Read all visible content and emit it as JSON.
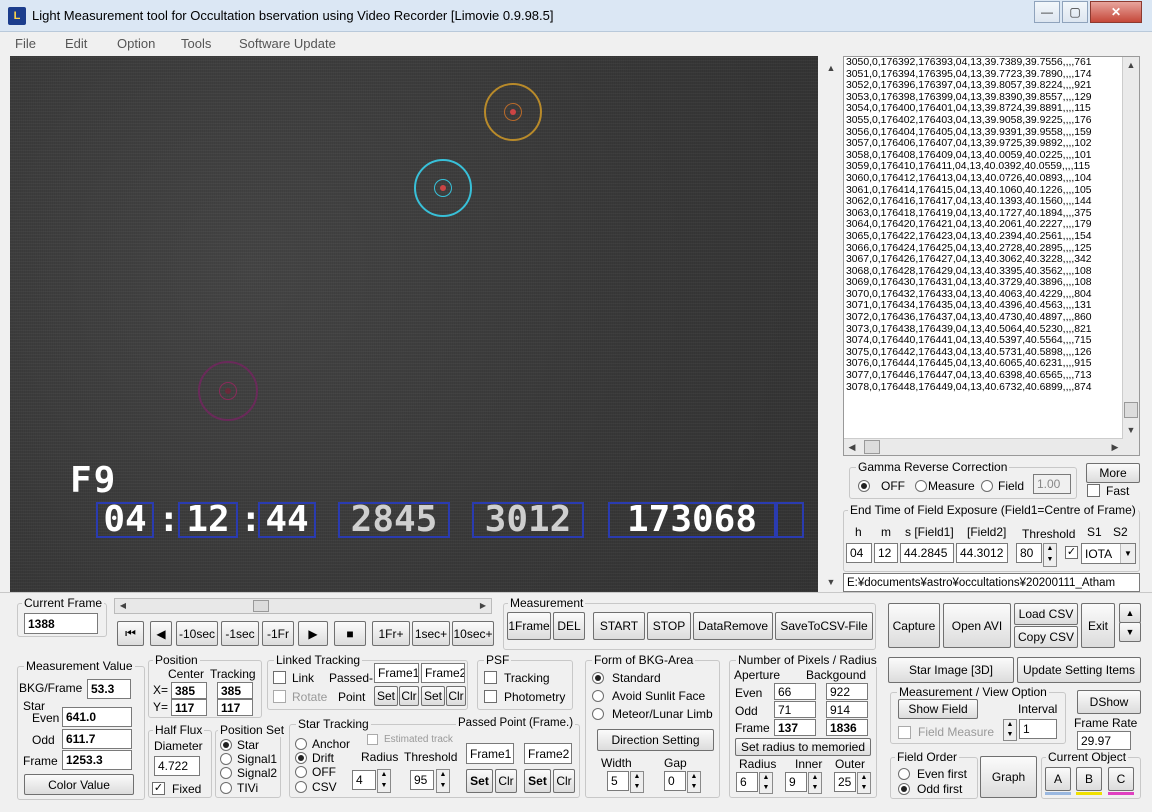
{
  "window": {
    "title": "Light Measurement tool for Occultation bservation using Video Recorder [Limovie 0.9.98.5]",
    "icon_text": "L"
  },
  "controls": {
    "minimize": "—",
    "maximize": "▢",
    "close": "✕"
  },
  "menu": [
    "File",
    "Edit",
    "Option",
    "Tools",
    "Software Update"
  ],
  "video": {
    "osd_field": "F9",
    "osd_time": [
      "04",
      ":",
      "12",
      ":",
      "44"
    ],
    "osd_values": [
      "2845",
      "3012",
      "173068"
    ]
  },
  "data_list": [
    "3050,0,176392,176393,04,13,39.7389,39.7556,,,,761",
    "3051,0,176394,176395,04,13,39.7723,39.7890,,,,174",
    "3052,0,176396,176397,04,13,39.8057,39.8224,,,,921",
    "3053,0,176398,176399,04,13,39.8390,39.8557,,,,129",
    "3054,0,176400,176401,04,13,39.8724,39.8891,,,,115",
    "3055,0,176402,176403,04,13,39.9058,39.9225,,,,176",
    "3056,0,176404,176405,04,13,39.9391,39.9558,,,,159",
    "3057,0,176406,176407,04,13,39.9725,39.9892,,,,102",
    "3058,0,176408,176409,04,13,40.0059,40.0225,,,,101",
    "3059,0,176410,176411,04,13,40.0392,40.0559,,,,115",
    "3060,0,176412,176413,04,13,40.0726,40.0893,,,,104",
    "3061,0,176414,176415,04,13,40.1060,40.1226,,,,105",
    "3062,0,176416,176417,04,13,40.1393,40.1560,,,,144",
    "3063,0,176418,176419,04,13,40.1727,40.1894,,,,375",
    "3064,0,176420,176421,04,13,40.2061,40.2227,,,,179",
    "3065,0,176422,176423,04,13,40.2394,40.2561,,,,154",
    "3066,0,176424,176425,04,13,40.2728,40.2895,,,,125",
    "3067,0,176426,176427,04,13,40.3062,40.3228,,,,342",
    "3068,0,176428,176429,04,13,40.3395,40.3562,,,,108",
    "3069,0,176430,176431,04,13,40.3729,40.3896,,,,108",
    "3070,0,176432,176433,04,13,40.4063,40.4229,,,,804",
    "3071,0,176434,176435,04,13,40.4396,40.4563,,,,131",
    "3072,0,176436,176437,04,13,40.4730,40.4897,,,,860",
    "3073,0,176438,176439,04,13,40.5064,40.5230,,,,821",
    "3074,0,176440,176441,04,13,40.5397,40.5564,,,,715",
    "3075,0,176442,176443,04,13,40.5731,40.5898,,,,126",
    "3076,0,176444,176445,04,13,40.6065,40.6231,,,,915",
    "3077,0,176446,176447,04,13,40.6398,40.6565,,,,713",
    "3078,0,176448,176449,04,13,40.6732,40.6899,,,,874"
  ],
  "gamma": {
    "title": "Gamma Reverse Correction",
    "options": [
      "OFF",
      "Measure",
      "Field"
    ],
    "selected": "OFF",
    "value": "1.00"
  },
  "more": {
    "label": "More",
    "fast_label": "Fast"
  },
  "endtime": {
    "title": "End Time of Field Exposure (Field1=Centre of Frame)",
    "headers": {
      "h": "h",
      "m": "m",
      "s": "s [Field1]",
      "field2": "[Field2]",
      "threshold": "Threshold",
      "s1": "S1",
      "s2": "S2"
    },
    "h": "04",
    "m": "12",
    "s": "44.2845",
    "field2": "44.3012",
    "threshold": "80",
    "iota": "IOTA"
  },
  "path": "E:¥documents¥astro¥occultations¥20200111_Atham",
  "current_frame": {
    "label": "Current Frame",
    "value": "1388"
  },
  "playback": [
    "⏮",
    "◀",
    "-10sec",
    "-1sec",
    "-1Fr",
    "▶",
    "■",
    "1Fr+",
    "1sec+",
    "10sec+"
  ],
  "measurement": {
    "title": "Measurement",
    "buttons": [
      "1Frame",
      "DEL",
      "START",
      "STOP",
      "DataRemove",
      "SaveToCSV-File"
    ]
  },
  "right_buttons": {
    "capture": "Capture",
    "open_avi": "Open AVI",
    "load_csv": "Load CSV",
    "copy_csv": "Copy CSV",
    "exit": "Exit"
  },
  "measure_value": {
    "title": "Measurement Value",
    "bkg_label": "BKG/Frame",
    "bkg": "53.3",
    "star_label": "Star",
    "even_label": "Even",
    "even": "641.0",
    "odd_label": "Odd",
    "odd": "611.7",
    "frame_label": "Frame",
    "frame": "1253.3",
    "color_btn": "Color Value"
  },
  "position": {
    "title": "Position",
    "center": "Center",
    "tracking": "Tracking",
    "x_label": "X=",
    "y_label": "Y=",
    "x_center": "385",
    "y_center": "117",
    "x_tracking": "385",
    "y_tracking": "117"
  },
  "linked": {
    "title": "Linked Tracking",
    "link": "Link",
    "rotate": "Rotate",
    "passed": "Passed-",
    "point": "Point",
    "frame1": "Frame1",
    "frame2": "Frame2",
    "set": "Set",
    "clr": "Clr"
  },
  "psf": {
    "title": "PSF",
    "tracking": "Tracking",
    "photometry": "Photometry"
  },
  "bkg_form": {
    "title": "Form of BKG-Area",
    "options": [
      "Standard",
      "Avoid Sunlit Face",
      "Meteor/Lunar Limb"
    ],
    "selected": "Standard",
    "direction": "Direction Setting",
    "width_label": "Width",
    "width": "5",
    "gap_label": "Gap",
    "gap": "0"
  },
  "pixels": {
    "title": "Number of Pixels / Radius",
    "aperture": "Aperture",
    "background": "Backgound",
    "even_label": "Even",
    "odd_label": "Odd",
    "frame_label": "Frame",
    "even_a": "66",
    "even_b": "922",
    "odd_a": "71",
    "odd_b": "914",
    "frame_a": "137",
    "frame_b": "1836",
    "set_btn": "Set  radius to memoried",
    "radius_label": "Radius",
    "inner_label": "Inner",
    "outer_label": "Outer",
    "radius": "6",
    "inner": "9",
    "outer": "25"
  },
  "star_image": "Star Image [3D]",
  "update_settings": "Update Setting Items",
  "view_option": {
    "title": "Measurement / View Option",
    "show_field": "Show Field",
    "interval_label": "Interval",
    "interval": "1",
    "field_measure": "Field Measure"
  },
  "dshow": "DShow",
  "frame_rate": {
    "label": "Frame Rate",
    "value": "29.97"
  },
  "half_flux": {
    "title": "Half Flux",
    "diameter": "Diameter",
    "value": "4.722",
    "fixed": "Fixed"
  },
  "position_set": {
    "title": "Position Set",
    "options": [
      "Star",
      "Signal1",
      "Signal2",
      "TIVi"
    ],
    "selected": "Star"
  },
  "star_tracking": {
    "title": "Star Tracking",
    "estimated": "Estimated track",
    "options": [
      "Anchor",
      "Drift",
      "OFF",
      "CSV"
    ],
    "selected": "Drift",
    "radius_label": "Radius",
    "threshold_label": "Threshold",
    "radius": "4",
    "threshold": "95",
    "passed_title": "Passed Point (Frame.)",
    "frame1": "Frame1",
    "frame2": "Frame2",
    "set": "Set",
    "clr": "Clr"
  },
  "field_order": {
    "title": "Field Order",
    "options": [
      "Even first",
      "Odd first"
    ],
    "selected": "Odd first"
  },
  "graph": "Graph",
  "current_object": {
    "title": "Current Object",
    "options": [
      "A",
      "B",
      "C"
    ],
    "colors": [
      "#9ab8e0",
      "#f0e000",
      "#e040c0"
    ]
  }
}
